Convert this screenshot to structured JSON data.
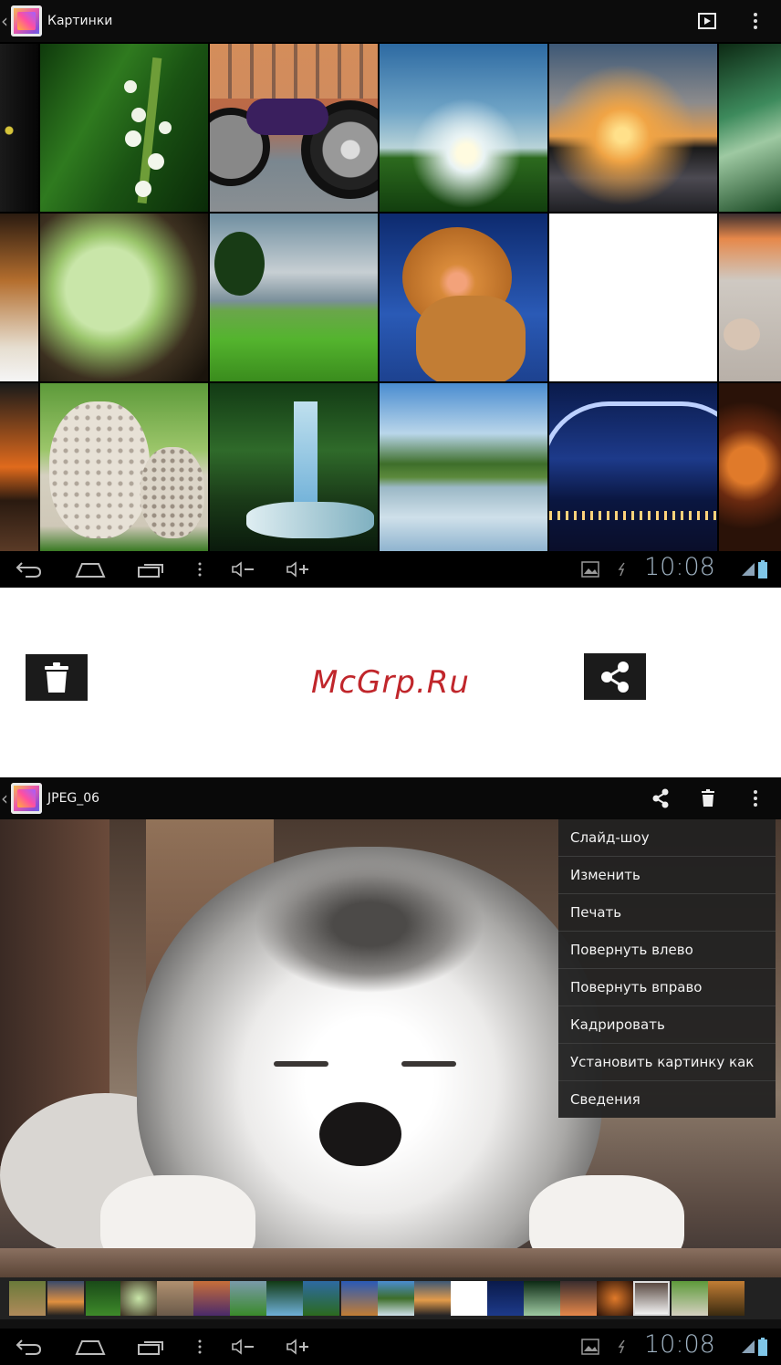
{
  "gallery": {
    "title": "Картинки",
    "clock": "10:08"
  },
  "watermark": "McGrp.Ru",
  "photo_view": {
    "title": "JPEG_06",
    "clock": "10:08",
    "menu": [
      "Слайд-шоу",
      "Изменить",
      "Печать",
      "Повернуть влево",
      "Повернуть вправо",
      "Кадрировать",
      "Установить картинку как",
      "Сведения"
    ]
  },
  "colors": {
    "actionbar": "#0c0c0c",
    "clock": "#9fb2c2",
    "watermark": "#c0262b"
  },
  "icons": [
    "back-icon",
    "home-icon",
    "recent-apps-icon",
    "menu-dots-icon",
    "volume-down-icon",
    "volume-up-icon",
    "slideshow-icon",
    "trash-icon",
    "share-icon",
    "gallery-app-icon",
    "screenshot-notification-icon",
    "usb-icon",
    "signal-icon",
    "battery-icon"
  ]
}
